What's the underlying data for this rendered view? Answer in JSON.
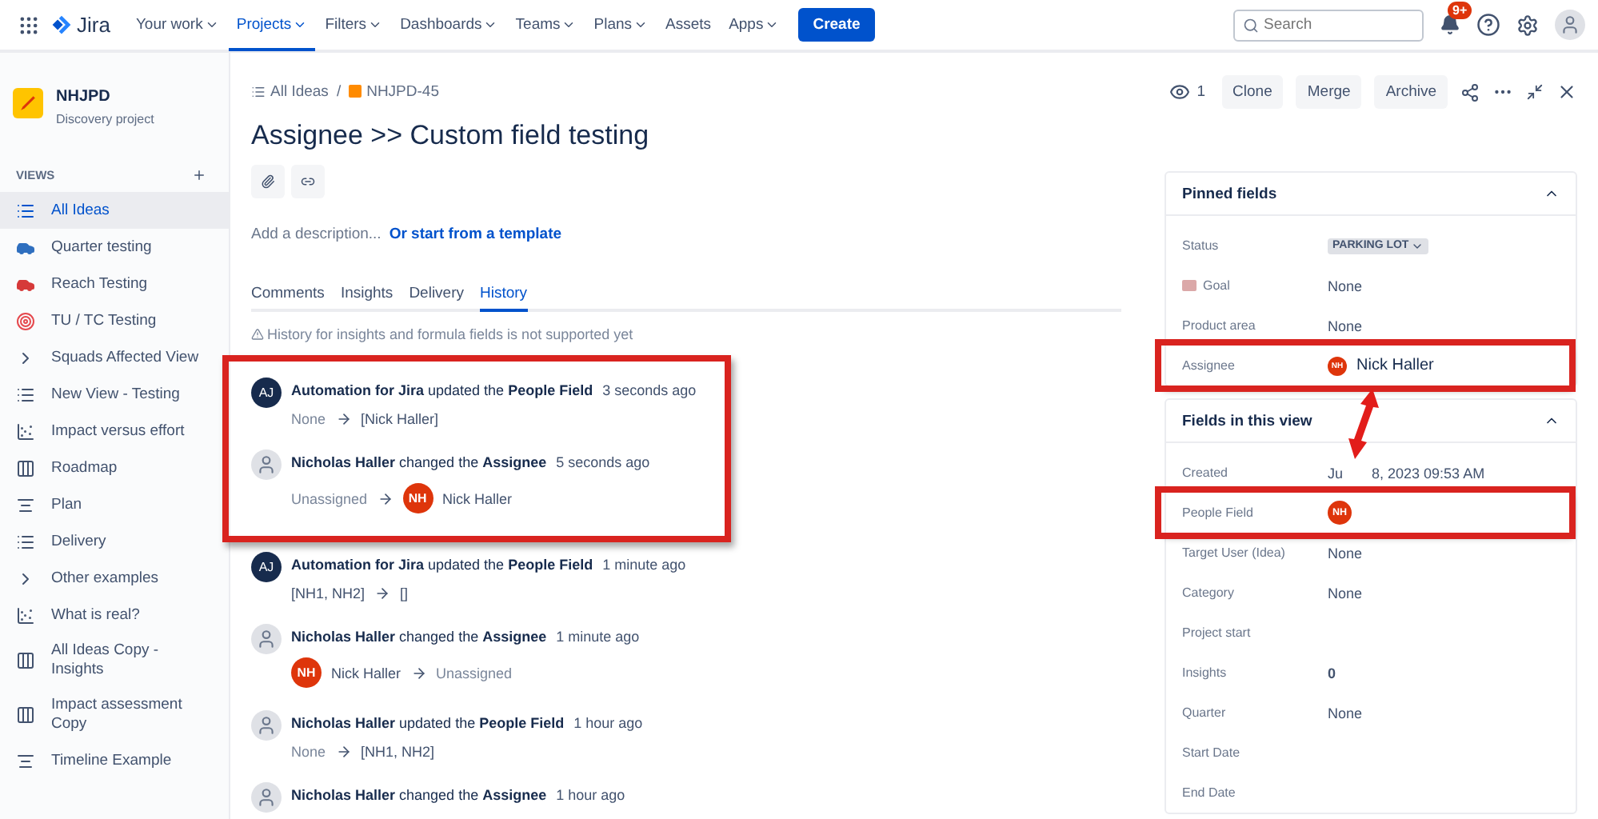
{
  "top_nav": {
    "product": "Jira",
    "items": [
      {
        "label": "Your work",
        "has_menu": true,
        "selected": false
      },
      {
        "label": "Projects",
        "has_menu": true,
        "selected": true
      },
      {
        "label": "Filters",
        "has_menu": true,
        "selected": false
      },
      {
        "label": "Dashboards",
        "has_menu": true,
        "selected": false
      },
      {
        "label": "Teams",
        "has_menu": true,
        "selected": false
      },
      {
        "label": "Plans",
        "has_menu": true,
        "selected": false
      },
      {
        "label": "Assets",
        "has_menu": false,
        "selected": false
      },
      {
        "label": "Apps",
        "has_menu": true,
        "selected": false
      }
    ],
    "create": "Create",
    "search": {
      "placeholder": "Search"
    },
    "notifications": "9+"
  },
  "sidebar": {
    "project": {
      "name": "NHJPD",
      "type": "Discovery project"
    },
    "section": "VIEWS",
    "items": [
      {
        "label": "All Ideas",
        "kind": "list",
        "selected": true
      },
      {
        "label": "Quarter testing",
        "kind": "vehicle",
        "color": "#2f6fbf",
        "selected": false
      },
      {
        "label": "Reach Testing",
        "kind": "vehicle",
        "color": "#d63a3a",
        "selected": false
      },
      {
        "label": "TU / TC Testing",
        "kind": "target",
        "selected": false
      },
      {
        "label": "Squads Affected View",
        "kind": "group",
        "selected": false
      },
      {
        "label": "New View - Testing",
        "kind": "list",
        "selected": false
      },
      {
        "label": "Impact versus effort",
        "kind": "chart",
        "selected": false
      },
      {
        "label": "Roadmap",
        "kind": "board",
        "selected": false
      },
      {
        "label": "Plan",
        "kind": "timeline",
        "selected": false
      },
      {
        "label": "Delivery",
        "kind": "list",
        "selected": false
      },
      {
        "label": "Other examples",
        "kind": "group",
        "selected": false
      },
      {
        "label": "What is real?",
        "kind": "chart",
        "selected": false
      },
      {
        "label": "All Ideas Copy - Insights",
        "kind": "board",
        "selected": false
      },
      {
        "label": "Impact assessment Copy",
        "kind": "board",
        "selected": false
      },
      {
        "label": "Timeline Example",
        "kind": "timeline",
        "selected": false
      }
    ]
  },
  "issue": {
    "breadcrumb": [
      "All Ideas",
      "NHJPD-45"
    ],
    "breadcrumb_separator": "/",
    "watchers": "1",
    "actions": [
      "Clone",
      "Merge",
      "Archive"
    ],
    "title": "Assignee >> Custom field testing",
    "description_placeholder": "Add a description...",
    "template_link": "Or start from a template",
    "tabs": [
      {
        "label": "Comments",
        "selected": false
      },
      {
        "label": "Insights",
        "selected": false
      },
      {
        "label": "Delivery",
        "selected": false
      },
      {
        "label": "History",
        "selected": true
      }
    ],
    "notice": "History for insights and formula fields is not supported yet",
    "history": [
      {
        "kind": "bot",
        "initials": "AJ",
        "text": "**Automation for Jira** updated the **People Field**",
        "time": "3 seconds ago",
        "from": {
          "text": "None",
          "muted": true
        },
        "to": {
          "text": "[Nick Haller]",
          "muted": false
        },
        "highlighted": true
      },
      {
        "kind": "person",
        "text": "**Nicholas Haller** changed the **Assignee**",
        "time": "5 seconds ago",
        "from": {
          "text": "Unassigned",
          "muted": true
        },
        "to": {
          "text": "Nick Haller",
          "avatar": "NH",
          "muted": false
        },
        "highlighted": true
      },
      {
        "kind": "bot",
        "initials": "AJ",
        "text": "**Automation for Jira** updated the **People Field**",
        "time": "1 minute ago",
        "from": {
          "text": "[NH1, NH2]",
          "muted": false
        },
        "to": {
          "text": "[]",
          "muted": false
        },
        "highlighted": false
      },
      {
        "kind": "person",
        "text": "**Nicholas Haller** changed the **Assignee**",
        "time": "1 minute ago",
        "from": {
          "text": "Nick Haller",
          "avatar": "NH",
          "muted": false
        },
        "to": {
          "text": "Unassigned",
          "muted": true
        },
        "highlighted": false
      },
      {
        "kind": "person",
        "text": "**Nicholas Haller** updated the **People Field**",
        "time": "1 hour ago",
        "from": {
          "text": "None",
          "muted": true
        },
        "to": {
          "text": "[NH1, NH2]",
          "muted": false
        },
        "highlighted": false
      },
      {
        "kind": "person",
        "text": "**Nicholas Haller** changed the **Assignee**",
        "time": "1 hour ago",
        "highlighted": false
      }
    ]
  },
  "pinned_fields": {
    "title": "Pinned fields",
    "fields": [
      {
        "label": "Status",
        "kind": "status",
        "value": "PARKING LOT",
        "highlighted": false
      },
      {
        "label": "Goal",
        "kind": "text",
        "value": "None",
        "has_icon": true,
        "highlighted": false
      },
      {
        "label": "Product area",
        "kind": "text",
        "value": "None",
        "highlighted": false
      },
      {
        "label": "Assignee",
        "kind": "user",
        "avatar": "NH",
        "value": "Nick Haller",
        "highlighted": true
      }
    ]
  },
  "view_fields": {
    "title": "Fields in this view",
    "fields": [
      {
        "label": "Created",
        "kind": "split",
        "value": "Ju",
        "value_after": "8, 2023 09:53 AM",
        "highlighted": false
      },
      {
        "label": "People Field",
        "kind": "user",
        "avatar": "NH",
        "highlighted": true
      },
      {
        "label": "Target User (Idea)",
        "kind": "text",
        "value": "None",
        "highlighted": false
      },
      {
        "label": "Category",
        "kind": "text",
        "value": "None",
        "highlighted": false
      },
      {
        "label": "Project start",
        "kind": "text",
        "highlighted": false
      },
      {
        "label": "Insights",
        "kind": "bold",
        "value": "0",
        "highlighted": false
      },
      {
        "label": "Quarter",
        "kind": "text",
        "value": "None",
        "highlighted": false
      },
      {
        "label": "Start Date",
        "kind": "text",
        "highlighted": false
      },
      {
        "label": "End Date",
        "kind": "text",
        "highlighted": false
      }
    ]
  }
}
